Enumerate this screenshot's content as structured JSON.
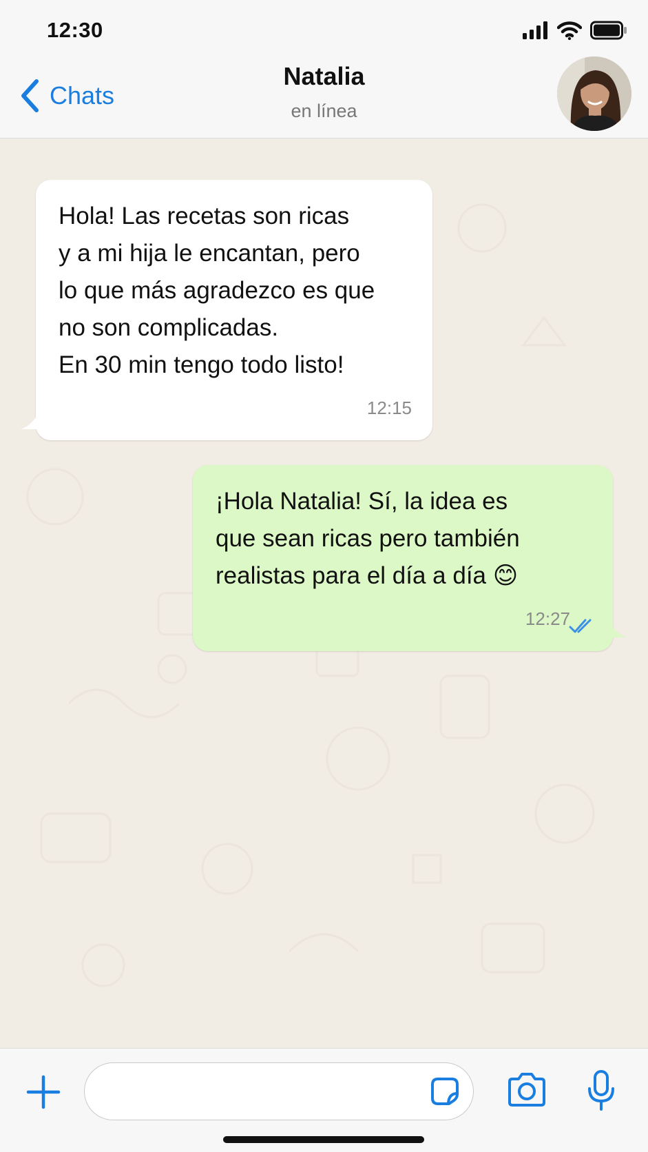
{
  "status_bar": {
    "time": "12:30",
    "icons": [
      "signal-icon",
      "wifi-icon",
      "battery-icon"
    ]
  },
  "header": {
    "back_label": "Chats",
    "contact_name": "Natalia",
    "contact_status": "en línea",
    "accent_color": "#1a7ee0"
  },
  "messages": [
    {
      "direction": "incoming",
      "text": "Hola! Las recetas son ricas\ny a mi hija le encantan, pero\nlo que más agradezco es que\nno son complicadas.\nEn 30 min tengo todo listo!",
      "time": "12:15",
      "bubble_color": "#ffffff"
    },
    {
      "direction": "outgoing",
      "text": "¡Hola Natalia! Sí, la idea es\nque sean ricas pero también\nrealistas para el día a día 😊",
      "time": "12:27",
      "status": "read",
      "bubble_color": "#dcf8c6"
    }
  ],
  "input_bar": {
    "placeholder": "",
    "icons": [
      "plus-icon",
      "sticker-icon",
      "camera-icon",
      "microphone-icon"
    ]
  }
}
